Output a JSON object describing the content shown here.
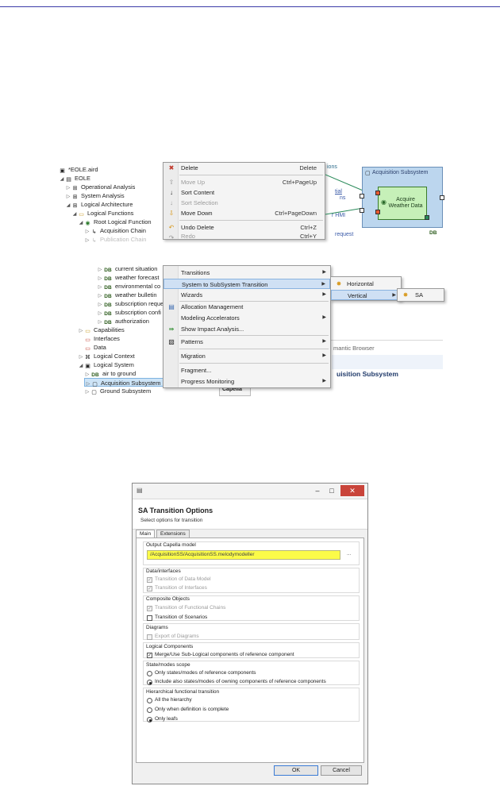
{
  "tree": {
    "top": [
      {
        "icon": "file-icon",
        "label": "*EOLE.aird"
      },
      {
        "icon": "project-icon",
        "label": "EOLE"
      },
      {
        "icon": "grid-icon",
        "label": "Operational Analysis"
      },
      {
        "icon": "grid-icon",
        "label": "System Analysis"
      },
      {
        "icon": "grid-icon",
        "label": "Logical Architecture"
      },
      {
        "icon": "folder-icon",
        "label": "Logical Functions"
      },
      {
        "icon": "function-icon",
        "label": "Root Logical Function"
      },
      {
        "icon": "chain-icon",
        "label": "Acquisition Chain"
      },
      {
        "icon": "chain-icon",
        "label": "Publication Chain"
      }
    ],
    "bottom": [
      {
        "icon": "db-icon",
        "label": "current situation"
      },
      {
        "icon": "db-icon",
        "label": "weather forecast"
      },
      {
        "icon": "db-icon",
        "label": "environmental co"
      },
      {
        "icon": "db-icon",
        "label": "weather bulletin"
      },
      {
        "icon": "db-icon",
        "label": "subscription reque"
      },
      {
        "icon": "db-icon",
        "label": "subscription confi"
      },
      {
        "icon": "db-icon",
        "label": "authorization"
      },
      {
        "icon": "folder-icon",
        "label": "Capabilities"
      },
      {
        "icon": "folder-red-icon",
        "label": "Interfaces"
      },
      {
        "icon": "folder-red-icon",
        "label": "Data"
      },
      {
        "icon": "context-icon",
        "label": "Logical Context"
      },
      {
        "icon": "system-icon",
        "label": "Logical System"
      },
      {
        "icon": "db-icon",
        "label": "air to ground"
      },
      {
        "icon": "component-icon",
        "label": "Acquisition Subsystem"
      },
      {
        "icon": "component-icon",
        "label": "Ground Subsystem"
      }
    ]
  },
  "menu1": {
    "items": [
      {
        "label": "Delete",
        "shortcut": "Delete",
        "icon": "delete-icon",
        "disabled": false
      },
      {
        "label": "Move Up",
        "shortcut": "Ctrl+PageUp",
        "icon": "move-up-icon",
        "disabled": true
      },
      {
        "label": "Sort Content",
        "shortcut": "",
        "icon": "sort-icon",
        "disabled": false
      },
      {
        "label": "Sort Selection",
        "shortcut": "",
        "icon": "sort-icon",
        "disabled": true
      },
      {
        "label": "Move Down",
        "shortcut": "Ctrl+PageDown",
        "icon": "move-down-icon",
        "disabled": false
      },
      {
        "label": "Undo Delete",
        "shortcut": "Ctrl+Z",
        "icon": "undo-icon",
        "disabled": false
      },
      {
        "label": "Redo",
        "shortcut": "Ctrl+Y",
        "icon": "redo-icon",
        "disabled": true
      }
    ]
  },
  "menu2": {
    "items": [
      {
        "label": "Transitions",
        "icon": "",
        "submenu": true
      },
      {
        "label": "System to SubSystem Transition",
        "icon": "",
        "submenu": true
      },
      {
        "label": "Wizards",
        "icon": "",
        "submenu": true
      },
      {
        "label": "Allocation Management",
        "icon": "allocation-icon",
        "submenu": false
      },
      {
        "label": "Modeling Accelerators",
        "icon": "",
        "submenu": true
      },
      {
        "label": "Show Impact Analysis...",
        "icon": "impact-icon",
        "submenu": false
      },
      {
        "label": "Patterns",
        "icon": "patterns-icon",
        "submenu": true
      },
      {
        "label": "Migration",
        "icon": "",
        "submenu": true
      },
      {
        "label": "Fragment...",
        "icon": "",
        "submenu": false
      },
      {
        "label": "Progress Monitoring",
        "icon": "",
        "submenu": true
      }
    ],
    "sub1": [
      "Horizontal",
      "Vertical"
    ],
    "sub2": [
      "SA"
    ]
  },
  "diagram": {
    "subsystem": "Acquisition Subsystem",
    "function_line1": "Acquire",
    "function_line2": "Weather Data",
    "frag_ions": "ions",
    "frag_tial": "tial",
    "frag_ns": "ns",
    "frag_hmi": "r HMI",
    "frag_request": "request",
    "badge": "DB"
  },
  "background": {
    "browser": "mantic Browser",
    "heading": "uisition Subsystem",
    "tab": "Capella"
  },
  "dialog": {
    "title": "SA Transition Options",
    "subtitle": "Select options for transition",
    "tabs": [
      "Main",
      "Extensions"
    ],
    "output_label": "Output Capella model",
    "output_path": "/AcquisitionSS/AcquisitionSS.melodymodeller",
    "browse": "...",
    "data_group": "Data/interfaces",
    "data_model": "Transition of Data Model",
    "interfaces": "Transition of Interfaces",
    "composite_group": "Composite Objects",
    "functional_chains": "Transition of Functional Chains",
    "scenarios": "Transition of Scenarios",
    "diagrams_group": "Diagrams",
    "export_diagrams": "Export of Diagrams",
    "logical_group": "Logical Components",
    "merge": "Merge/Use Sub-Logical components of reference component",
    "state_group": "State/modes scope",
    "state_opt1": "Only states/modes of reference components",
    "state_opt2": "Include also states/modes of owning components of reference components",
    "hier_group": "Hierarchical functional transition",
    "hier_opt1": "All the hierarchy",
    "hier_opt2": "Only when definition is complete",
    "hier_opt3": "Only leafs",
    "ok": "OK",
    "cancel": "Cancel"
  },
  "colors": {
    "highlight": "#fbfb48",
    "menu_selection": "#cfe0f4",
    "close_button": "#c9443a"
  }
}
